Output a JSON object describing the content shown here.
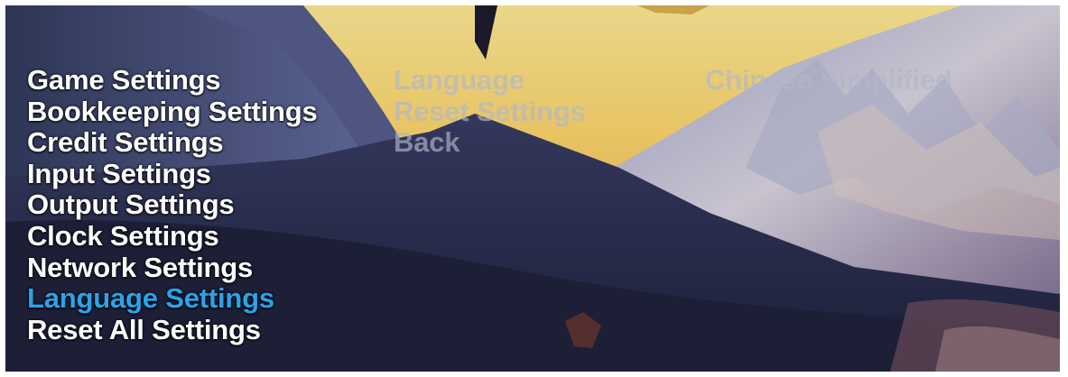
{
  "menu": {
    "items": [
      {
        "label": "Game Settings",
        "selected": false
      },
      {
        "label": "Bookkeeping Settings",
        "selected": false
      },
      {
        "label": "Credit Settings",
        "selected": false
      },
      {
        "label": "Input Settings",
        "selected": false
      },
      {
        "label": "Output Settings",
        "selected": false
      },
      {
        "label": "Clock Settings",
        "selected": false
      },
      {
        "label": "Network Settings",
        "selected": false
      },
      {
        "label": "Language Settings",
        "selected": true
      },
      {
        "label": "Reset All Settings",
        "selected": false
      }
    ]
  },
  "submenu": {
    "items": [
      {
        "label": "Language"
      },
      {
        "label": "Reset Settings"
      },
      {
        "label": "Back"
      }
    ]
  },
  "values": {
    "language": "Chinese Simplified"
  },
  "colors": {
    "selected": "#2aa3ea",
    "normal": "#ffffff",
    "inactive": "#b2b6c8"
  }
}
